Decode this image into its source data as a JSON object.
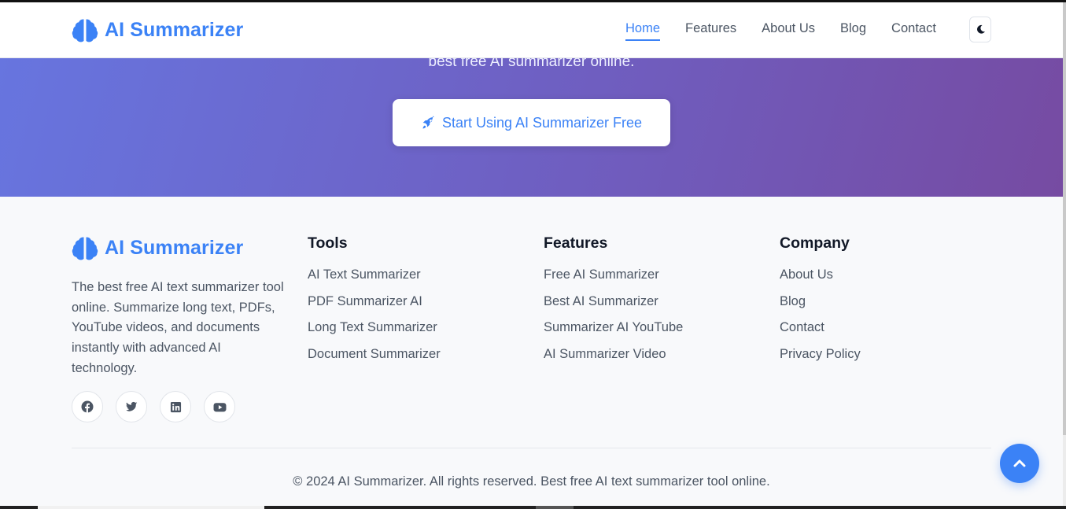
{
  "brand": {
    "name": "AI Summarizer",
    "color": "#3b82f6"
  },
  "nav": {
    "items": [
      {
        "label": "Home",
        "active": true
      },
      {
        "label": "Features"
      },
      {
        "label": "About Us"
      },
      {
        "label": "Blog"
      },
      {
        "label": "Contact"
      }
    ],
    "theme_icon": "moon-icon"
  },
  "hero": {
    "text": "best free AI summarizer online.",
    "cta_label": "Start Using AI Summarizer Free",
    "cta_icon": "rocket-icon",
    "gradient": [
      "#667eea",
      "#764ba2"
    ]
  },
  "footer": {
    "brand": "AI Summarizer",
    "about": "The best free AI text summarizer tool online. Summarize long text, PDFs, YouTube videos, and documents instantly with advanced AI technology.",
    "socials": [
      "facebook-icon",
      "twitter-icon",
      "linkedin-icon",
      "youtube-icon"
    ],
    "columns": [
      {
        "title": "Tools",
        "links": [
          "AI Text Summarizer",
          "PDF Summarizer AI",
          "Long Text Summarizer",
          "Document Summarizer"
        ]
      },
      {
        "title": "Features",
        "links": [
          "Free AI Summarizer",
          "Best AI Summarizer",
          "Summarizer AI YouTube",
          "AI Summarizer Video"
        ]
      },
      {
        "title": "Company",
        "links": [
          "About Us",
          "Blog",
          "Contact",
          "Privacy Policy"
        ]
      }
    ],
    "copyright": "© 2024 AI Summarizer. All rights reserved. Best free AI text summarizer tool online."
  },
  "back_to_top_icon": "chevron-up-icon"
}
